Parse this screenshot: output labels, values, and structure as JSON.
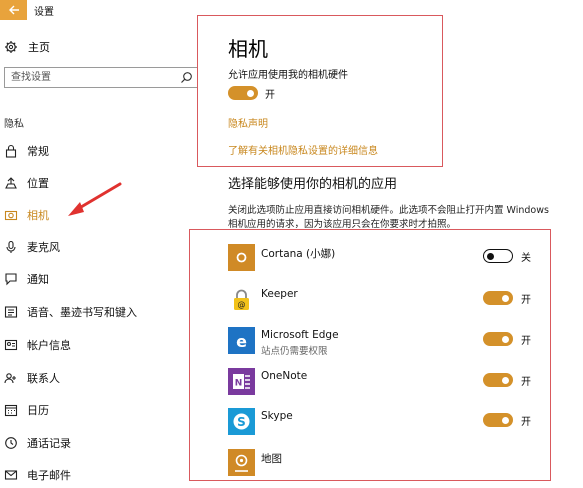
{
  "window": {
    "title": "设置"
  },
  "sidebar": {
    "home_label": "主页",
    "search_placeholder": "查找设置",
    "section_label": "隐私",
    "items": [
      {
        "label": "常规",
        "icon": "lock-icon"
      },
      {
        "label": "位置",
        "icon": "location-icon"
      },
      {
        "label": "相机",
        "icon": "camera-icon",
        "active": true
      },
      {
        "label": "麦克风",
        "icon": "microphone-icon"
      },
      {
        "label": "通知",
        "icon": "notification-icon"
      },
      {
        "label": "语音、墨迹书写和键入",
        "icon": "pen-icon"
      },
      {
        "label": "帐户信息",
        "icon": "account-icon"
      },
      {
        "label": "联系人",
        "icon": "contacts-icon"
      },
      {
        "label": "日历",
        "icon": "calendar-icon"
      },
      {
        "label": "通话记录",
        "icon": "call-history-icon"
      },
      {
        "label": "电子邮件",
        "icon": "email-icon"
      }
    ]
  },
  "main": {
    "title": "相机",
    "allow_label": "允许应用使用我的相机硬件",
    "allow_state": "开",
    "privacy_link": "隐私声明",
    "details_link": "了解有关相机隐私设置的详细信息",
    "section_title": "选择能够使用你的相机的应用",
    "description": "关闭此选项防止应用直接访问相机硬件。此选项不会阻止打开内置 Windows 相机应用的请求，因为该应用只会在你要求时才拍照。",
    "apps": [
      {
        "name": "Cortana (小娜)",
        "state": "关",
        "on": false,
        "icon": "cortana-icon",
        "color": "#d08a26"
      },
      {
        "name": "Keeper",
        "state": "开",
        "on": true,
        "icon": "keeper-lock-icon",
        "color": "#ffffff"
      },
      {
        "name": "Microsoft Edge",
        "sub": "站点仍需要权限",
        "state": "开",
        "on": true,
        "icon": "edge-icon",
        "color": "#1e73c4"
      },
      {
        "name": "OneNote",
        "state": "开",
        "on": true,
        "icon": "onenote-icon",
        "color": "#7a3a9e"
      },
      {
        "name": "Skype",
        "state": "开",
        "on": true,
        "icon": "skype-icon",
        "color": "#1a9ad6"
      },
      {
        "name": "地图",
        "state": "",
        "on": null,
        "icon": "maps-icon",
        "color": "#d08a26"
      }
    ]
  },
  "colors": {
    "accent": "#d4912a",
    "highlight_box": "#d9595d",
    "back_button": "#e8a33c"
  }
}
